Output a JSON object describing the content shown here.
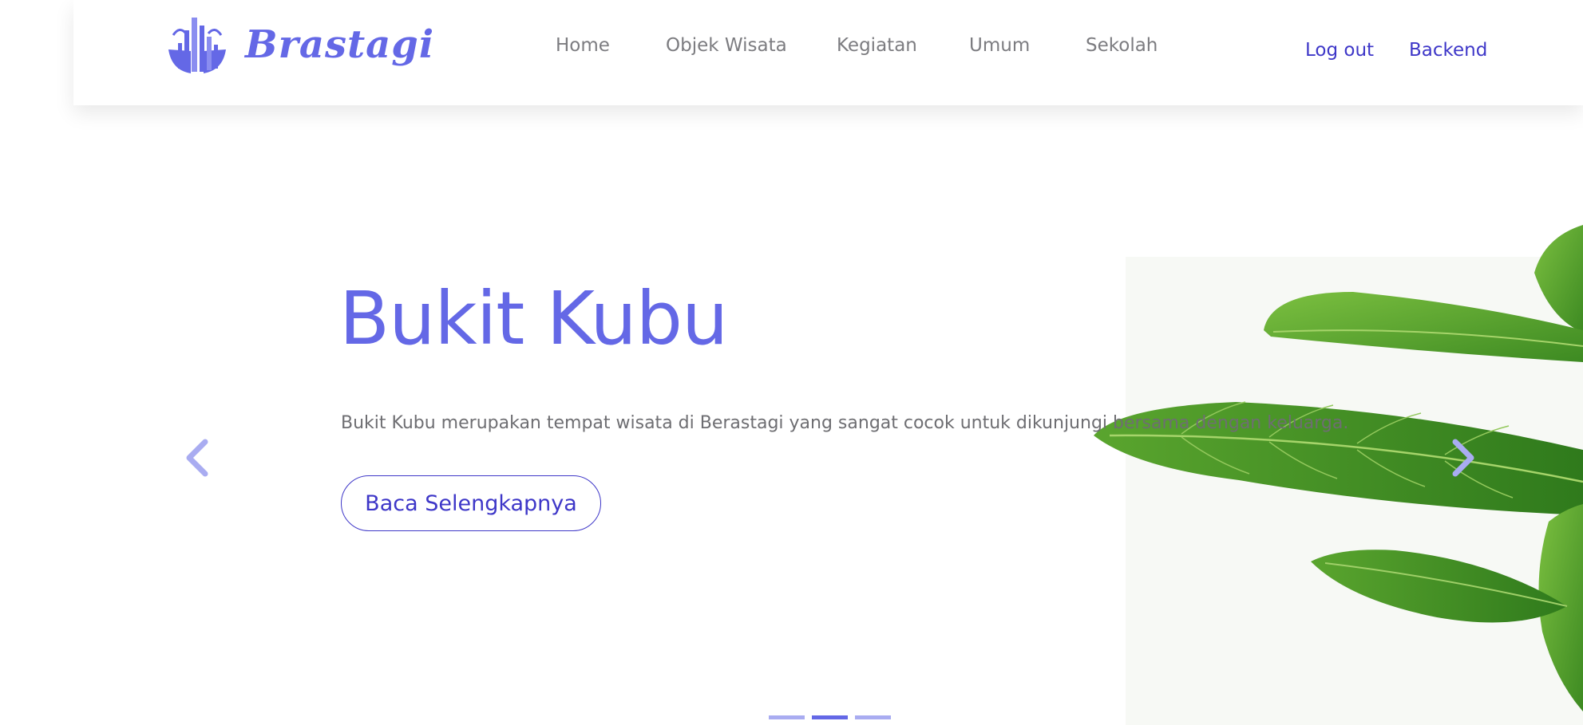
{
  "brand": {
    "name": "Brastagi",
    "logo_icon": "city-skyline-logo-icon",
    "color": "#6468e6"
  },
  "nav": {
    "links": [
      {
        "label": "Home"
      },
      {
        "label": "Objek Wisata"
      },
      {
        "label": "Kegiatan"
      },
      {
        "label": "Umum"
      },
      {
        "label": "Sekolah"
      }
    ],
    "logout_label": "Log out",
    "backend_label": "Backend",
    "link_color": "#7c7c80",
    "action_color": "#3e37c8"
  },
  "carousel": {
    "slide": {
      "title": "Bukit Kubu",
      "description": "Bukit Kubu merupakan tempat wisata di Berastagi yang sangat cocok untuk dikunjungi bersama dengan keluarga.",
      "cta_label": "Baca Selengkapnya",
      "image": "green-leaves-plant-image"
    },
    "prev_icon": "chevron-left-icon",
    "next_icon": "chevron-right-icon",
    "indicator_count": 3,
    "active_indicator": 2,
    "accent_color": "#6468e6"
  }
}
